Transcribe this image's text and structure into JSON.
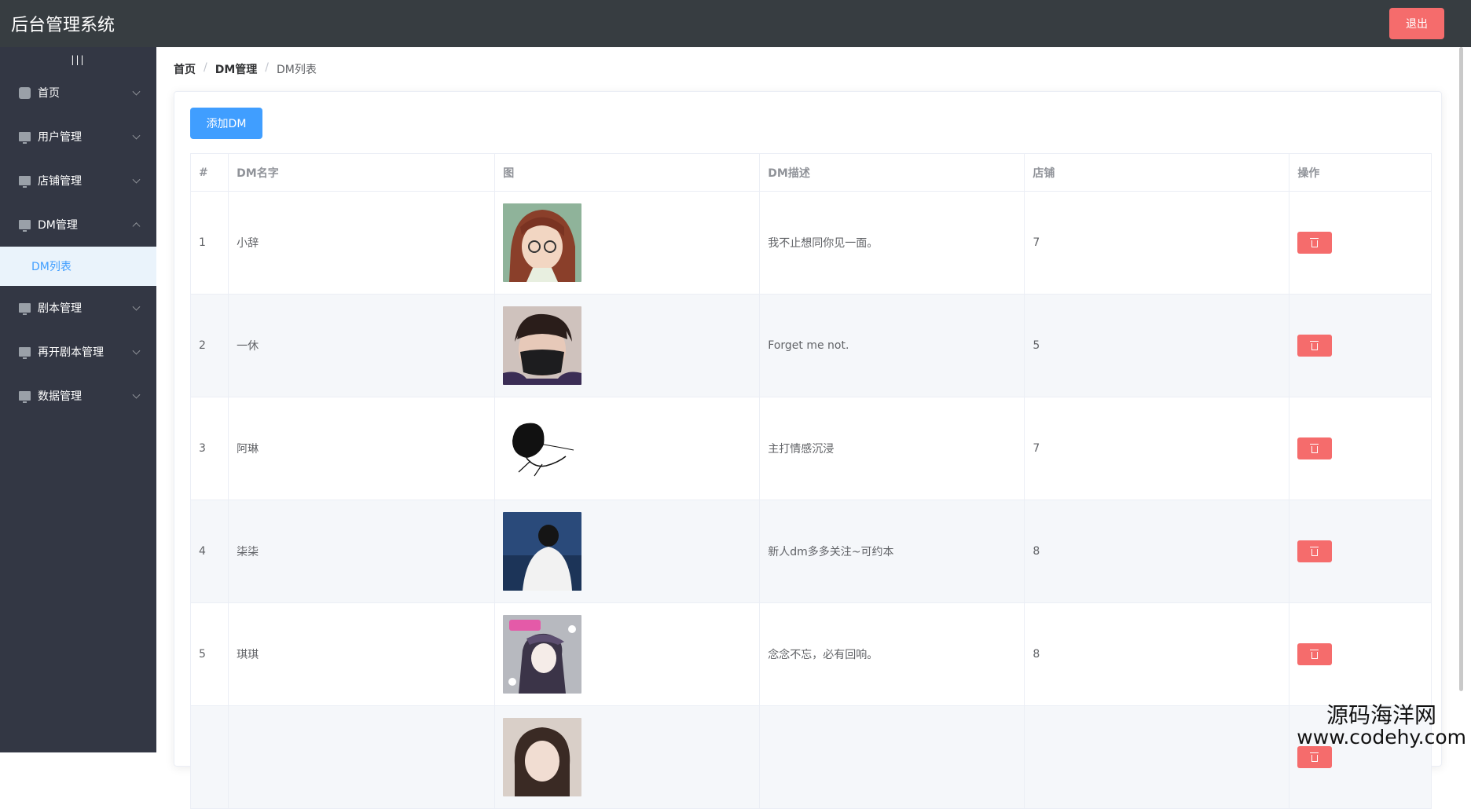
{
  "header": {
    "title": "后台管理系统",
    "logout_label": "退出"
  },
  "sidebar": {
    "toggle": "|||",
    "items": [
      {
        "label": "首页",
        "icon": "home-icon"
      },
      {
        "label": "用户管理",
        "icon": "monitor-icon"
      },
      {
        "label": "店铺管理",
        "icon": "monitor-icon"
      },
      {
        "label": "DM管理",
        "icon": "monitor-icon",
        "expanded": true
      },
      {
        "label": "剧本管理",
        "icon": "monitor-icon"
      },
      {
        "label": "再开剧本管理",
        "icon": "monitor-icon"
      },
      {
        "label": "数据管理",
        "icon": "monitor-icon"
      }
    ],
    "active_subitem": "DM列表"
  },
  "breadcrumb": {
    "home": "首页",
    "section": "DM管理",
    "current": "DM列表",
    "separator": "/"
  },
  "toolbar": {
    "add_label": "添加DM"
  },
  "table": {
    "headers": [
      "#",
      "DM名字",
      "图",
      "DM描述",
      "店铺",
      "操作"
    ],
    "rows": [
      {
        "index": "1",
        "name": "小辞",
        "desc": "我不止想同你见一面。",
        "shop": "7"
      },
      {
        "index": "2",
        "name": "一休",
        "desc": "Forget me not.",
        "shop": "5"
      },
      {
        "index": "3",
        "name": "阿琳",
        "desc": "主打情感沉浸",
        "shop": "7"
      },
      {
        "index": "4",
        "name": "柒柒",
        "desc": "新人dm多多关注~可约本",
        "shop": "8"
      },
      {
        "index": "5",
        "name": "琪琪",
        "desc": "念念不忘，必有回响。",
        "shop": "8"
      },
      {
        "index": "",
        "name": "",
        "desc": "",
        "shop": ""
      }
    ]
  },
  "watermark": {
    "line1": "源码海洋网",
    "line2": "www.codehy.com"
  },
  "colors": {
    "topbar": "#373d41",
    "sidebar": "#333744",
    "primary": "#409eff",
    "danger": "#f56c6c"
  }
}
